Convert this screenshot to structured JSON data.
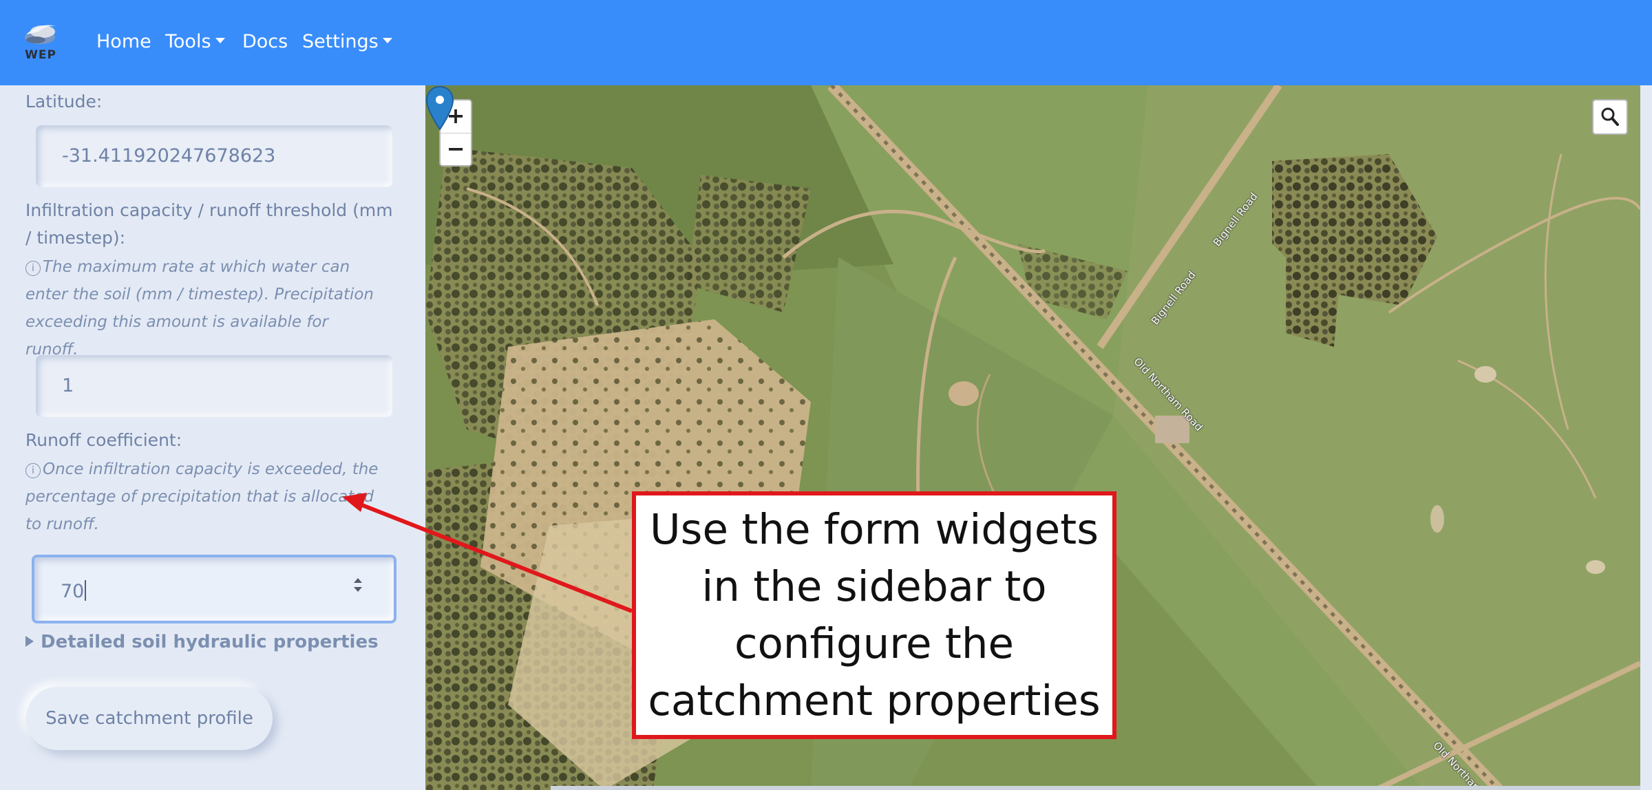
{
  "navbar": {
    "logo_text": "WEP",
    "items": [
      {
        "label": "Home"
      },
      {
        "label": "Tools"
      },
      {
        "label": "Docs"
      },
      {
        "label": "Settings"
      }
    ],
    "color": "#398dfb"
  },
  "sidebar": {
    "latitude_label": "Latitude:",
    "latitude_value": "-31.411920247678623",
    "infiltration_label": "Infiltration capacity / runoff threshold (mm / timestep):",
    "infiltration_help": "The maximum rate at which water can enter the soil (mm / timestep). Precipitation exceeding this amount is available for runoff.",
    "infiltration_value": "1",
    "runoff_label": "Runoff coefficient:",
    "runoff_help": "Once infiltration capacity is exceeded, the percentage of precipitation that is allocated to runoff.",
    "runoff_value": "70",
    "details_label": "Detailed soil hydraulic properties",
    "save_label": "Save catchment profile"
  },
  "map": {
    "zoom_in": "+",
    "zoom_out": "−",
    "search_icon": "magnifier-icon",
    "road_labels": [
      "Bignell Road",
      "Bignell Road",
      "Old Northam Road",
      "Old Northam Road"
    ]
  },
  "annotation": {
    "text": "Use the form widgets in the sidebar to configure the catchment properties",
    "border_color": "#e0181b"
  }
}
